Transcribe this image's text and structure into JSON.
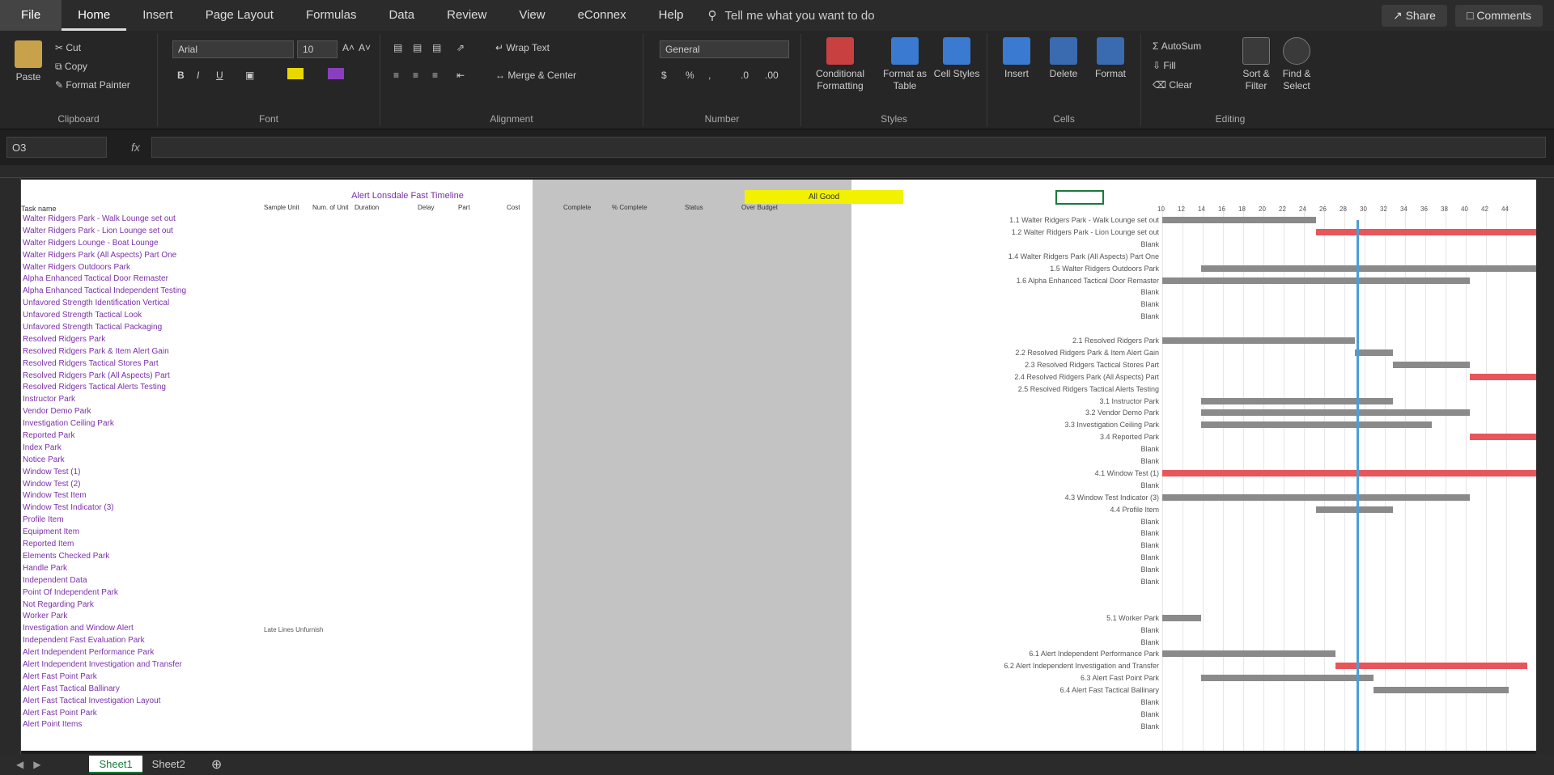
{
  "menu": {
    "tabs": [
      "File",
      "Home",
      "Insert",
      "Page Layout",
      "Formulas",
      "Data",
      "Review",
      "View",
      "eConnex",
      "Help"
    ],
    "tell_me": "Tell me what you want to do",
    "share": "Share",
    "comments": "Comments"
  },
  "ribbon": {
    "clipboard": {
      "paste": "Paste",
      "cut": "Cut",
      "copy": "Copy",
      "format_painter": "Format Painter",
      "label": "Clipboard"
    },
    "font": {
      "name": "Arial",
      "size": "10",
      "label": "Font"
    },
    "alignment": {
      "wrap": "Wrap Text",
      "merge": "Merge & Center",
      "label": "Alignment"
    },
    "number": {
      "format": "General",
      "label": "Number"
    },
    "styles": {
      "conditional": "Conditional Formatting",
      "format_table": "Format as Table",
      "cell_styles": "Cell Styles",
      "label": "Styles"
    },
    "cells": {
      "insert": "Insert",
      "delete": "Delete",
      "format": "Format",
      "label": "Cells"
    },
    "editing": {
      "autosum": "AutoSum",
      "fill": "Fill",
      "clear": "Clear",
      "sort": "Sort & Filter",
      "find": "Find & Select",
      "label": "Editing"
    }
  },
  "formula_bar": {
    "name_box": "O3",
    "fx": "fx"
  },
  "sheet": {
    "title": "Alert Lonsdale Fast Timeline",
    "status_cell": "All Good",
    "task_header": "Task name",
    "tasks": [
      "Walter Ridgers Park - Walk Lounge set out",
      "Walter Ridgers Park - Lion Lounge set out",
      "Walter Ridgers Lounge - Boat Lounge",
      "Walter Ridgers Park (All Aspects) Part One",
      "Walter Ridgers Outdoors Park",
      "Alpha Enhanced Tactical Door Remaster",
      "Alpha Enhanced Tactical Independent Testing",
      "Unfavored Strength Identification Vertical",
      "Unfavored Strength Tactical Look",
      "Unfavored Strength Tactical Packaging",
      "Resolved Ridgers Park",
      "Resolved Ridgers Park & Item Alert Gain",
      "Resolved Ridgers Tactical Stores Part",
      "Resolved Ridgers Park (All Aspects) Part",
      "Resolved Ridgers Tactical Alerts Testing",
      "Instructor Park",
      "Vendor Demo Park",
      "Investigation Ceiling Park",
      "Reported Park",
      "Index Park",
      "Notice Park",
      "Window Test (1)",
      "Window Test (2)",
      "Window Test Item",
      "Window Test Indicator (3)",
      "Profile Item",
      "Equipment Item",
      "Reported Item",
      "Elements Checked Park",
      "Handle Park",
      "Independent Data",
      "Point Of Independent Park",
      "Not Regarding Park",
      "Worker Park",
      "Investigation and Window Alert",
      "Independent Fast Evaluation Park",
      "Alert Independent Performance Park",
      "Alert Independent Investigation and Transfer",
      "Alert Fast Point Park",
      "Alert Fast Tactical Ballinary",
      "Alert Fast Tactical Investigation Layout",
      "Alert Fast Point Park",
      "Alert Point Items"
    ],
    "col_headers": [
      "Sample Unit",
      "Num. of Unit",
      "Duration",
      "Delay",
      "Part",
      "Cost",
      "Complete",
      "% Complete",
      "Status",
      "Over Budget"
    ],
    "date_note": "Late Lines Unfurnish",
    "gantt_axis": [
      "10",
      "12",
      "14",
      "16",
      "18",
      "20",
      "22",
      "24",
      "26",
      "28",
      "30",
      "32",
      "34",
      "36",
      "38",
      "40",
      "42",
      "44"
    ],
    "gantt_labels": [
      {
        "t": "1.1  Walter Ridgers Park - Walk Lounge set out",
        "row": 0,
        "s": 0,
        "e": 200,
        "c": "#8a8a8a"
      },
      {
        "t": "1.2  Walter Ridgers Park - Lion Lounge set out",
        "row": 1,
        "s": 200,
        "e": 530,
        "c": "#e8555a"
      },
      {
        "t": "Blank",
        "row": 2,
        "s": 0,
        "e": 0,
        "c": ""
      },
      {
        "t": "1.4  Walter Ridgers Park (All Aspects) Part One",
        "row": 3,
        "s": 530,
        "e": 720,
        "c": "#e8555a"
      },
      {
        "t": "1.5  Walter Ridgers Outdoors Park",
        "row": 4,
        "s": 50,
        "e": 550,
        "c": "#8a8a8a"
      },
      {
        "t": "1.6  Alpha Enhanced Tactical Door Remaster",
        "row": 5,
        "s": 0,
        "e": 400,
        "c": "#8a8a8a"
      },
      {
        "t": "Blank",
        "row": 6,
        "s": 0,
        "e": 0,
        "c": ""
      },
      {
        "t": "Blank",
        "row": 7,
        "s": 0,
        "e": 0,
        "c": ""
      },
      {
        "t": "Blank",
        "row": 8,
        "s": 0,
        "e": 0,
        "c": ""
      },
      {
        "t": "2.1  Resolved Ridgers Park",
        "row": 10,
        "s": 0,
        "e": 250,
        "c": "#8a8a8a"
      },
      {
        "t": "2.2  Resolved Ridgers Park & Item Alert Gain",
        "row": 11,
        "s": 250,
        "e": 300,
        "c": "#8a8a8a"
      },
      {
        "t": "2.3  Resolved Ridgers Tactical Stores Part",
        "row": 12,
        "s": 300,
        "e": 400,
        "c": "#8a8a8a"
      },
      {
        "t": "2.4  Resolved Ridgers Park (All Aspects) Part",
        "row": 13,
        "s": 400,
        "e": 500,
        "c": "#e8555a"
      },
      {
        "t": "2.5  Resolved Ridgers Tactical Alerts Testing",
        "row": 14,
        "s": 500,
        "e": 600,
        "c": "#e8555a"
      },
      {
        "t": "3.1  Instructor Park",
        "row": 15,
        "s": 50,
        "e": 300,
        "c": "#8a8a8a"
      },
      {
        "t": "3.2  Vendor Demo Park",
        "row": 16,
        "s": 50,
        "e": 400,
        "c": "#8a8a8a"
      },
      {
        "t": "3.3  Investigation Ceiling Park",
        "row": 17,
        "s": 50,
        "e": 350,
        "c": "#8a8a8a"
      },
      {
        "t": "3.4  Reported Park",
        "row": 18,
        "s": 400,
        "e": 500,
        "c": "#e8555a"
      },
      {
        "t": "Blank",
        "row": 19,
        "s": 0,
        "e": 0,
        "c": ""
      },
      {
        "t": "Blank",
        "row": 20,
        "s": 0,
        "e": 0,
        "c": ""
      },
      {
        "t": "4.1  Window Test (1)",
        "row": 21,
        "s": 0,
        "e": 500,
        "c": "#e8555a"
      },
      {
        "t": "Blank",
        "row": 22,
        "s": 0,
        "e": 0,
        "c": ""
      },
      {
        "t": "4.3  Window Test Indicator (3)",
        "row": 23,
        "s": 0,
        "e": 400,
        "c": "#8a8a8a"
      },
      {
        "t": "4.4  Profile Item",
        "row": 24,
        "s": 200,
        "e": 300,
        "c": "#8a8a8a"
      },
      {
        "t": "Blank",
        "row": 25,
        "s": 0,
        "e": 0,
        "c": ""
      },
      {
        "t": "Blank",
        "row": 26,
        "s": 0,
        "e": 0,
        "c": ""
      },
      {
        "t": "Blank",
        "row": 27,
        "s": 0,
        "e": 0,
        "c": ""
      },
      {
        "t": "Blank",
        "row": 28,
        "s": 0,
        "e": 0,
        "c": ""
      },
      {
        "t": "Blank",
        "row": 29,
        "s": 0,
        "e": 0,
        "c": ""
      },
      {
        "t": "Blank",
        "row": 30,
        "s": 0,
        "e": 0,
        "c": ""
      },
      {
        "t": "5.1  Worker Park",
        "row": 33,
        "s": 0,
        "e": 50,
        "c": "#8a8a8a"
      },
      {
        "t": "Blank",
        "row": 34,
        "s": 0,
        "e": 0,
        "c": ""
      },
      {
        "t": "Blank",
        "row": 35,
        "s": 0,
        "e": 0,
        "c": ""
      },
      {
        "t": "6.1  Alert Independent Performance Park",
        "row": 36,
        "s": 0,
        "e": 225,
        "c": "#8a8a8a"
      },
      {
        "t": "6.2  Alert Independent Investigation and Transfer",
        "row": 37,
        "s": 225,
        "e": 475,
        "c": "#e8555a"
      },
      {
        "t": "6.3  Alert Fast Point Park",
        "row": 38,
        "s": 50,
        "e": 275,
        "c": "#8a8a8a"
      },
      {
        "t": "6.4  Alert Fast Tactical Ballinary",
        "row": 39,
        "s": 275,
        "e": 450,
        "c": "#8a8a8a"
      },
      {
        "t": "Blank",
        "row": 40,
        "s": 0,
        "e": 0,
        "c": ""
      },
      {
        "t": "Blank",
        "row": 41,
        "s": 0,
        "e": 0,
        "c": ""
      },
      {
        "t": "Blank",
        "row": 42,
        "s": 0,
        "e": 0,
        "c": ""
      }
    ],
    "today_fraction": 0.52
  },
  "tabs": {
    "sheet1": "Sheet1",
    "sheet2": "Sheet2"
  },
  "colors": {
    "accent": "#1a7a3a",
    "bar_grey": "#8a8a8a",
    "bar_red": "#e8555a",
    "today": "#4a9fd8"
  }
}
